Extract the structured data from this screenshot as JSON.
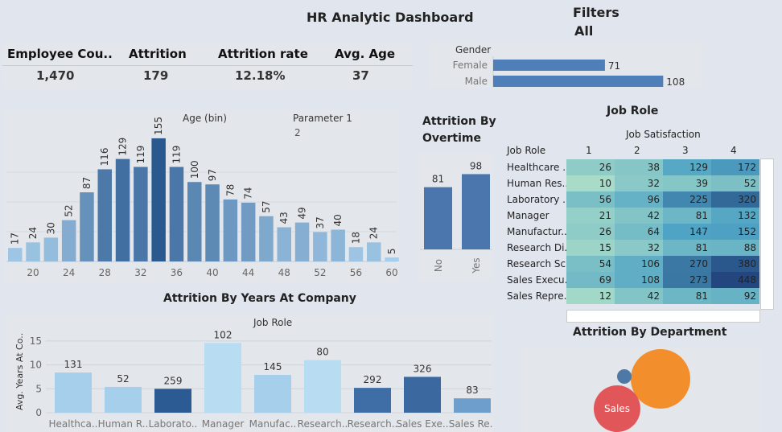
{
  "dashboard_title": "HR Analytic Dashboard",
  "filters": {
    "title": "Filters",
    "value": "All"
  },
  "kpis": [
    {
      "label": "Employee Cou..",
      "value": "1,470"
    },
    {
      "label": "Attrition",
      "value": "179"
    },
    {
      "label": "Attrition rate",
      "value": "12.18%"
    },
    {
      "label": "Avg. Age",
      "value": "37"
    }
  ],
  "colors": {
    "bar_dark": "#2f5f98",
    "bar_mid": "#4e7fb8",
    "bar_light": "#a6cce8",
    "orange": "#f28e2b",
    "red": "#e15759",
    "blue": "#4e79a7"
  },
  "chart_data": [
    {
      "id": "gender",
      "type": "bar",
      "title": "Gender",
      "categories": [
        "Female",
        "Male"
      ],
      "values": [
        71,
        108
      ]
    },
    {
      "id": "age",
      "type": "bar",
      "title": "Age (bin)",
      "parameter_label": "Parameter 1",
      "parameter_value": "2",
      "x": [
        18,
        20,
        22,
        24,
        26,
        28,
        30,
        32,
        34,
        36,
        38,
        40,
        42,
        44,
        46,
        48,
        50,
        52,
        54,
        56,
        58,
        60
      ],
      "values": [
        17,
        24,
        30,
        52,
        87,
        116,
        129,
        119,
        155,
        119,
        100,
        97,
        78,
        74,
        57,
        43,
        49,
        37,
        40,
        18,
        24,
        5
      ],
      "x_ticks": [
        "20",
        "24",
        "28",
        "32",
        "36",
        "40",
        "44",
        "48",
        "52",
        "56",
        "60"
      ],
      "ylim": [
        0,
        160
      ]
    },
    {
      "id": "overtime",
      "type": "bar",
      "title": "Attrition By Overtime",
      "categories": [
        "No",
        "Yes"
      ],
      "values": [
        81,
        98
      ],
      "ylim": [
        0,
        110
      ]
    },
    {
      "id": "jobrole_heatmap",
      "type": "heatmap",
      "title": "Job Role",
      "column_header": "Job Satisfaction",
      "row_header": "Job Role",
      "columns": [
        "1",
        "2",
        "3",
        "4"
      ],
      "rows": [
        "Healthcare ..",
        "Human Res..",
        "Laboratory ..",
        "Manager",
        "Manufactur..",
        "Research Di..",
        "Research Sc..",
        "Sales Execu..",
        "Sales Repre.."
      ],
      "values": [
        [
          26,
          38,
          129,
          172
        ],
        [
          10,
          32,
          39,
          52
        ],
        [
          56,
          96,
          225,
          320
        ],
        [
          21,
          42,
          81,
          132
        ],
        [
          26,
          64,
          147,
          152
        ],
        [
          15,
          32,
          81,
          88
        ],
        [
          54,
          106,
          270,
          380
        ],
        [
          69,
          108,
          273,
          448
        ],
        [
          12,
          42,
          81,
          92
        ]
      ],
      "vrange": [
        10,
        448
      ]
    },
    {
      "id": "years",
      "type": "bar",
      "title": "Attrition By Years At Company",
      "subtitle": "Job Role",
      "ylabel": "Avg. Years At Co..",
      "categories": [
        "Healthca..",
        "Human R..",
        "Laborato..",
        "Manager",
        "Manufac..",
        "Research..",
        "Research..",
        "Sales Exe..",
        "Sales Re.."
      ],
      "values": [
        8.4,
        5.4,
        5.0,
        14.6,
        7.9,
        11.0,
        5.2,
        7.5,
        3.0
      ],
      "labels": [
        "131",
        "52",
        "259",
        "102",
        "145",
        "80",
        "292",
        "326",
        "83"
      ],
      "yticks": [
        0,
        5,
        10,
        15
      ],
      "ylim": [
        0,
        17
      ]
    },
    {
      "id": "department",
      "type": "scatter",
      "title": "Attrition By Department",
      "categories": [
        "Sales"
      ],
      "label": "Sales"
    }
  ]
}
